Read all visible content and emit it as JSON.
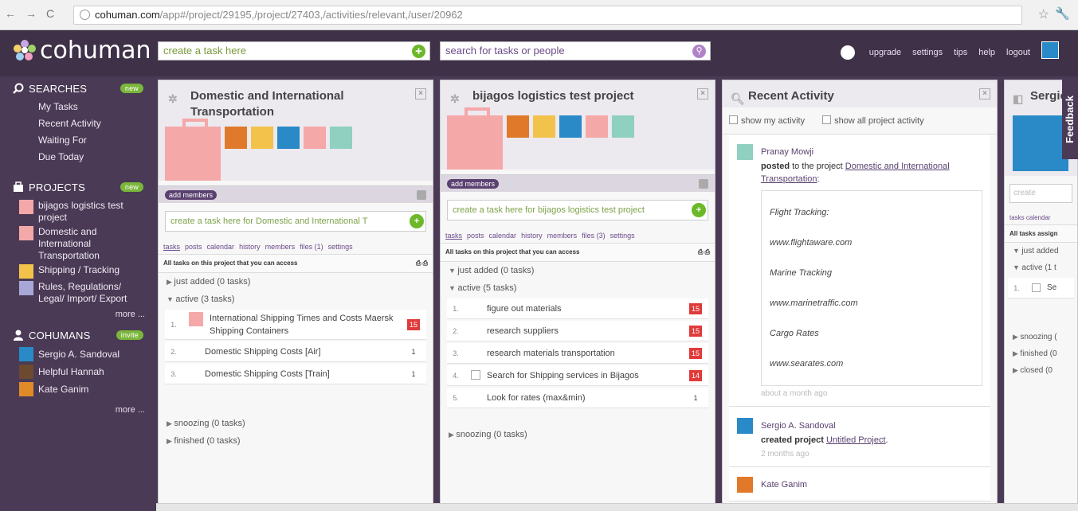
{
  "browser": {
    "url_host": "cohuman.com",
    "url_path": "/app#/project/29195,/project/27403,/activities/relevant,/user/20962"
  },
  "app": {
    "name": "cohuman"
  },
  "topbar": {
    "create_placeholder": "create a task here",
    "search_placeholder": "search for tasks or people",
    "links": [
      "upgrade",
      "settings",
      "tips",
      "help",
      "logout"
    ]
  },
  "sidebar": {
    "searches": {
      "title": "SEARCHES",
      "badge": "new",
      "items": [
        "My Tasks",
        "Recent Activity",
        "Waiting For",
        "Due Today"
      ]
    },
    "projects": {
      "title": "PROJECTS",
      "badge": "new",
      "items": [
        {
          "label": "bijagos logistics test project",
          "color": "#f5a8a8"
        },
        {
          "label": "Domestic and International Transportation",
          "color": "#f5a8a8"
        },
        {
          "label": "Shipping / Tracking",
          "color": "#f3c24a"
        },
        {
          "label": "Rules, Regulations/ Legal/ Import/ Export",
          "color": "#a8a8d8"
        }
      ],
      "more": "more ..."
    },
    "cohumans": {
      "title": "COHUMANS",
      "badge": "invite",
      "items": [
        "Sergio A. Sandoval",
        "Helpful Hannah",
        "Kate Ganim"
      ],
      "more": "more ..."
    }
  },
  "panel1": {
    "title": "Domestic and International Transportation",
    "add_members": "add members",
    "create_task": "create a task here for Domestic and International T",
    "tabs": [
      "tasks",
      "posts",
      "calendar",
      "history",
      "members",
      "files (1)",
      "settings"
    ],
    "all_tasks": "All tasks on this project that you can access",
    "groups": {
      "just_added": "just added (0 tasks)",
      "active": "active (3 tasks)",
      "snoozing": "snoozing (0 tasks)",
      "finished": "finished (0 tasks)"
    },
    "tasks": [
      {
        "n": "1.",
        "title": "International Shipping Times and Costs Maersk Shipping Containers",
        "count": "15",
        "red": true
      },
      {
        "n": "2.",
        "title": "Domestic Shipping Costs [Air]",
        "count": "1",
        "red": false
      },
      {
        "n": "3.",
        "title": "Domestic Shipping Costs [Train]",
        "count": "1",
        "red": false
      }
    ]
  },
  "panel2": {
    "title": "bijagos logistics test project",
    "add_members": "add members",
    "create_task": "create a task here for bijagos logistics test project",
    "tabs": [
      "tasks",
      "posts",
      "calendar",
      "history",
      "members",
      "files (3)",
      "settings"
    ],
    "all_tasks": "All tasks on this project that you can access",
    "groups": {
      "just_added": "just added (0 tasks)",
      "active": "active (5 tasks)",
      "snoozing": "snoozing (0 tasks)"
    },
    "tasks": [
      {
        "n": "1.",
        "title": "figure out materials",
        "count": "15",
        "red": true
      },
      {
        "n": "2.",
        "title": "research suppliers",
        "count": "15",
        "red": true
      },
      {
        "n": "3.",
        "title": "research materials transportation",
        "count": "15",
        "red": true
      },
      {
        "n": "4.",
        "title": "Search for Shipping services in Bijagos",
        "count": "14",
        "red": true
      },
      {
        "n": "5.",
        "title": "Look for rates (max&min)",
        "count": "1",
        "red": false
      }
    ]
  },
  "panel3": {
    "title": "Recent Activity",
    "show_my": "show my activity",
    "show_all": "show all project activity",
    "items": [
      {
        "who": "Pranay Mowji",
        "verb": "posted",
        "text": " to the project ",
        "link": "Domestic and International Transportation",
        "tail": ":",
        "quote": [
          "Flight Tracking:",
          "www.flightaware.com",
          "Marine Tracking",
          "www.marinetraffic.com",
          "Cargo Rates",
          "www.searates.com"
        ],
        "ago": "about a month ago"
      },
      {
        "who": "Sergio A. Sandoval",
        "verb": "created project",
        "text": " ",
        "link": "Untitled Project",
        "tail": ".",
        "ago": "2 months ago"
      },
      {
        "who": "Kate Ganim"
      }
    ]
  },
  "panel4": {
    "title": "Sergio",
    "create": "create",
    "tabs": "tasks  calendar",
    "all_tasks": "All tasks assign",
    "groups": [
      "just added",
      "active (1 t",
      "snoozing (",
      "finished (0",
      "closed (0"
    ],
    "task_label": "Se",
    "feedback": "Feedback"
  }
}
